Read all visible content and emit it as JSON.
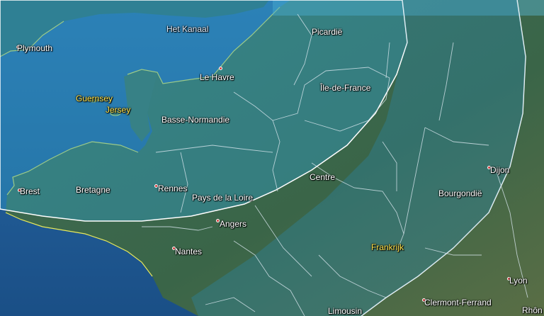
{
  "map": {
    "labels": {
      "het_kanaal": "Het Kanaal",
      "plymouth": "Plymouth",
      "picardie": "Picardië",
      "le_havre": "Le Havre",
      "ile_de_france": "Île-de-France",
      "guernsey": "Guernsey",
      "jersey": "Jersey",
      "basse_normandie": "Basse-Normandie",
      "brest": "Brest",
      "bretagne": "Bretagne",
      "rennes": "Rennes",
      "pays_de_la_loire": "Pays de la Loire",
      "centre": "Centre",
      "dijon": "Dijon",
      "bourgondie": "Bourgondië",
      "angers": "Angers",
      "nantes": "Nantes",
      "frankrijk": "Frankrijk",
      "lyon": "Lyon",
      "clermont_ferrand": "Clermont-Ferrand",
      "limousin": "Limousin",
      "rhon": "Rhôn"
    },
    "colors": {
      "sea": "#1d5f9a",
      "land": "#3c6b4e",
      "overlay": "#2a8ab0",
      "boundary": "#ffffff",
      "coast_highlight": "#e8e85a",
      "city_dot": "#d64040"
    }
  }
}
